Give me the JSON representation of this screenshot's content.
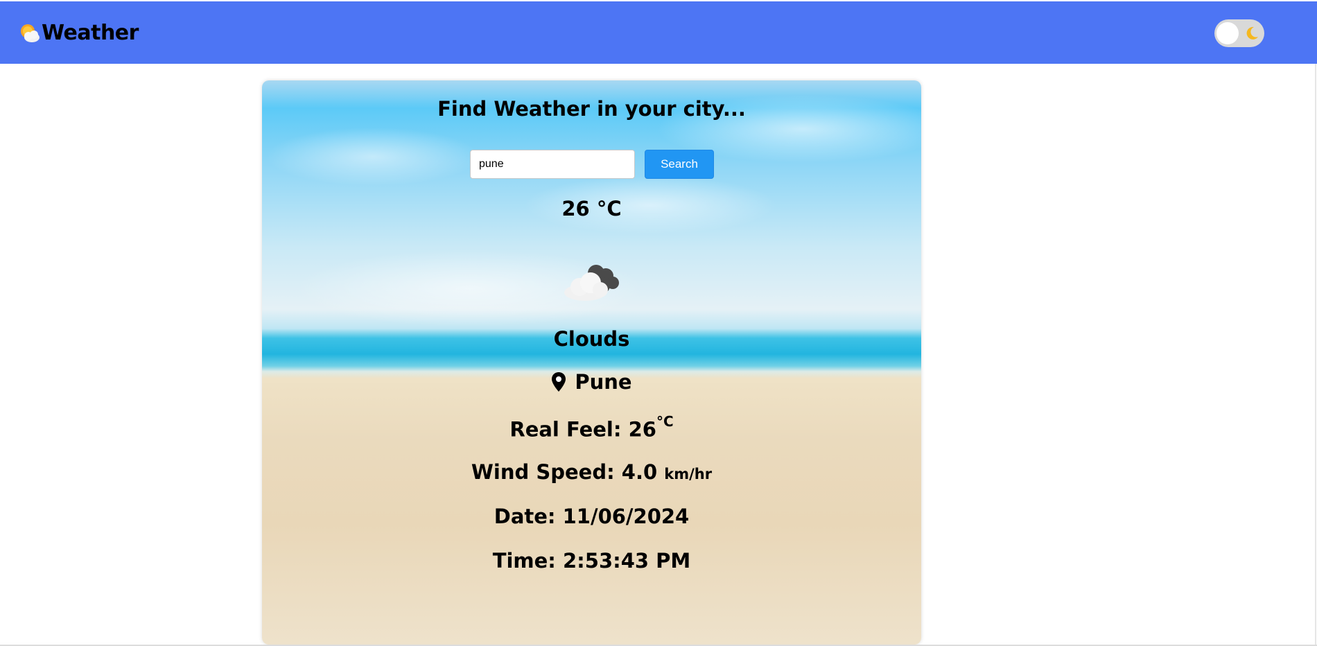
{
  "navbar": {
    "title": "Weather",
    "logo_icon": "sun-behind-cloud-icon",
    "theme_toggle": {
      "icon": "moon-icon",
      "state": "light"
    },
    "background_color": "#4d75f4"
  },
  "card": {
    "heading": "Find Weather in your city...",
    "search": {
      "value": "pune",
      "button_label": "Search"
    },
    "temperature": "26 °C",
    "condition_icon": "clouds-icon",
    "condition": "Clouds",
    "location": {
      "icon": "map-pin-icon",
      "city": "Pune"
    },
    "real_feel": {
      "label": "Real Feel: 26",
      "unit": "°C"
    },
    "wind_speed": {
      "label": "Wind Speed: 4.0",
      "unit": "km/hr"
    },
    "date": "Date: 11/06/2024",
    "time": "Time: 2:53:43 PM"
  },
  "colors": {
    "search_button": "#2196f3"
  }
}
